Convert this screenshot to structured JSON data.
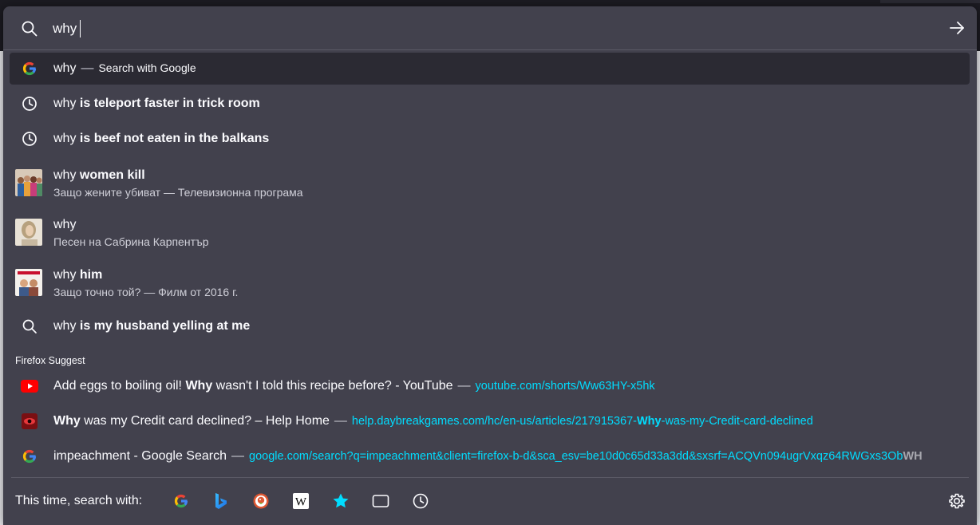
{
  "urlbar": {
    "query": "why"
  },
  "suggestions": [
    {
      "query": "why",
      "rest": "",
      "action": "Search with Google",
      "icon": "google-icon"
    },
    {
      "query": "why",
      "rest": " is teleport faster in trick room",
      "icon": "history-clock-icon"
    },
    {
      "query": "why",
      "rest": " is beef not eaten in the balkans",
      "icon": "history-clock-icon"
    },
    {
      "query": "why",
      "rest": " women kill",
      "sub": "Защо жените убиват — Телевизионна програма",
      "icon": "thumbnail-women-kill"
    },
    {
      "query": "why",
      "rest": "",
      "sub": "Песен на Сабрина Карпентър",
      "icon": "thumbnail-sabrina"
    },
    {
      "query": "why",
      "rest": " him",
      "sub": "Защо точно той? — Филм от 2016 г.",
      "icon": "thumbnail-why-him"
    },
    {
      "query": "why",
      "rest": " is my husband yelling at me",
      "icon": "search-icon"
    }
  ],
  "firefox_suggest": {
    "label": "Firefox Suggest",
    "items": [
      {
        "title_pre": "Add eggs to boiling oil! ",
        "title_bold": "Why",
        "title_post": " wasn't I told this recipe before? - YouTube",
        "url_pre": "youtube.com/shorts/Ww63HY-x5hk",
        "url_bold": "",
        "url_post": "",
        "icon": "youtube-icon"
      },
      {
        "title_pre": "",
        "title_bold": "Why",
        "title_post": " was my Credit card declined? – Help Home",
        "url_pre": "help.daybreakgames.com/hc/en-us/articles/217915367-",
        "url_bold": "Why",
        "url_post": "-was-my-Credit-card-declined",
        "icon": "daybreak-icon"
      },
      {
        "title_pre": "impeachment - Google Search",
        "title_bold": "",
        "title_post": "",
        "url_pre": "google.com/search?q=impeachment&client=firefox-b-d&sca_esv=be10d0c65d33a3dd&sxsrf=ACQVn094ugrVxqz64RWGxs3Ob",
        "url_bold": "WH",
        "url_post": "",
        "icon": "google-icon"
      }
    ]
  },
  "dash": "—",
  "footer": {
    "label": "This time, search with:",
    "engines": [
      "google-icon",
      "bing-icon",
      "duckduckgo-icon",
      "wikipedia-icon",
      "bookmarks-star-icon",
      "tabs-icon",
      "history-icon"
    ]
  },
  "colors": {
    "panel": "#42414d",
    "selected": "#2b2a33",
    "url": "#00ddff",
    "text": "#fbfbfe"
  }
}
